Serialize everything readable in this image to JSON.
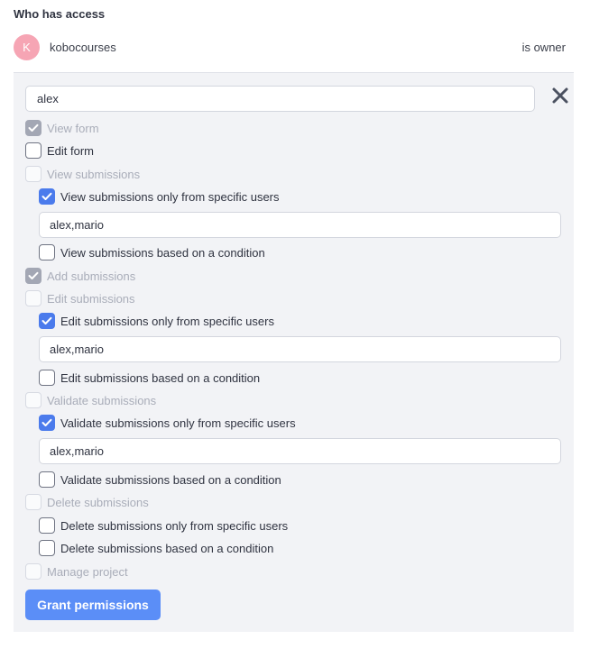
{
  "section": {
    "heading": "Who has access"
  },
  "owner": {
    "initial": "K",
    "name": "kobocourses",
    "role": "is owner"
  },
  "form": {
    "user_input_value": "alex",
    "close_icon": "close-icon",
    "colors": {
      "accent": "#4b7bec",
      "button": "#5b8ef7",
      "disabled_check": "#a3a7b4"
    },
    "permissions": [
      {
        "label": "View form",
        "checked": true,
        "disabled": true
      },
      {
        "label": "Edit form",
        "checked": false,
        "disabled": false
      },
      {
        "label": "View submissions",
        "checked": false,
        "disabled": true
      },
      {
        "label": "View submissions only from specific users",
        "checked": true,
        "disabled": false
      },
      {
        "label": "View submissions based on a condition",
        "checked": false,
        "disabled": false
      },
      {
        "label": "Add submissions",
        "checked": true,
        "disabled": true
      },
      {
        "label": "Edit submissions",
        "checked": false,
        "disabled": true
      },
      {
        "label": "Edit submissions only from specific users",
        "checked": true,
        "disabled": false
      },
      {
        "label": "Edit submissions based on a condition",
        "checked": false,
        "disabled": false
      },
      {
        "label": "Validate submissions",
        "checked": false,
        "disabled": true
      },
      {
        "label": "Validate submissions only from specific users",
        "checked": true,
        "disabled": false
      },
      {
        "label": "Validate submissions based on a condition",
        "checked": false,
        "disabled": false
      },
      {
        "label": "Delete submissions",
        "checked": false,
        "disabled": true
      },
      {
        "label": "Delete submissions only from specific users",
        "checked": false,
        "disabled": false
      },
      {
        "label": "Delete submissions based on a condition",
        "checked": false,
        "disabled": false
      },
      {
        "label": "Manage project",
        "checked": false,
        "disabled": true
      }
    ],
    "user_lists": [
      {
        "value": "alex,mario"
      },
      {
        "value": "alex,mario"
      },
      {
        "value": "alex,mario"
      }
    ],
    "submit_label": "Grant permissions"
  }
}
